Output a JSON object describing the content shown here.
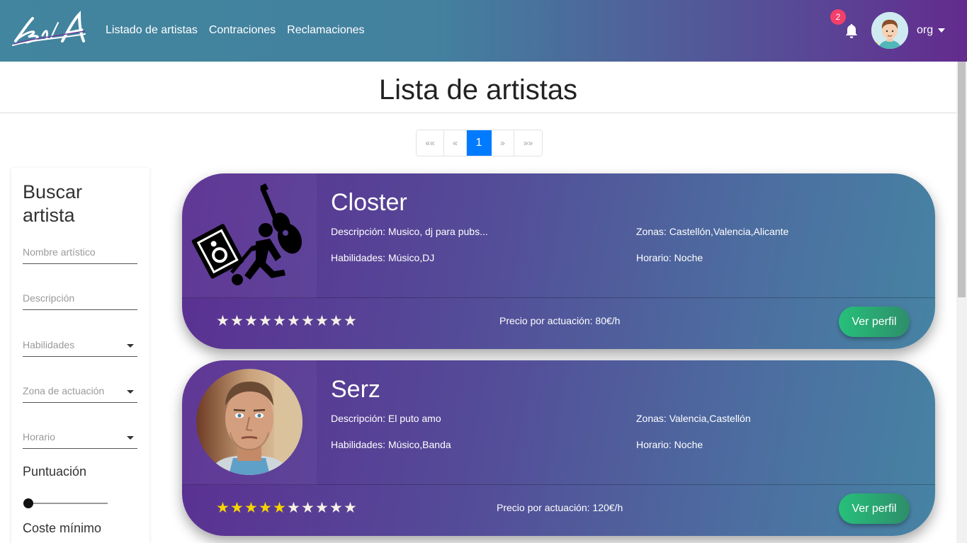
{
  "nav": {
    "links": [
      "Listado de artistas",
      "Contraciones",
      "Reclamaciones"
    ],
    "notification_count": "2",
    "user": "org"
  },
  "page": {
    "title": "Lista de artistas"
  },
  "pagination": {
    "first": "««",
    "prev": "«",
    "current": "1",
    "next": "»",
    "last": "»»"
  },
  "sidebar": {
    "title": "Buscar artista",
    "name_placeholder": "Nombre artístico",
    "description_placeholder": "Descripción",
    "skills_placeholder": "Habilidades",
    "zone_placeholder": "Zona de actuación",
    "schedule_placeholder": "Horario",
    "rating_label": "Puntuación",
    "rating_value": 0,
    "min_cost_label": "Coste mínimo"
  },
  "artists": [
    {
      "name": "Closter",
      "description": "Descripción: Musico, dj para pubs...",
      "zones": "Zonas: Castellón,Valencia,Alicante",
      "skills": "Habilidades: Músico,DJ",
      "schedule": "Horario: Noche",
      "rating": 0,
      "price": "Precio por actuación: 80€/h",
      "button": "Ver perfil",
      "image": "musician-pictogram"
    },
    {
      "name": "Serz",
      "description": "Descripción: El puto amo",
      "zones": "Zonas: Valencia,Castellón",
      "skills": "Habilidades: Músico,Banda",
      "schedule": "Horario: Noche",
      "rating": 5,
      "price": "Precio por actuación: 120€/h",
      "button": "Ver perfil",
      "image": "man-portrait"
    }
  ],
  "rating_max": 10,
  "colors": {
    "accent": "#007bff",
    "button": "#26c07a",
    "star_on": "#f5d400",
    "badge": "#f43f6a"
  }
}
